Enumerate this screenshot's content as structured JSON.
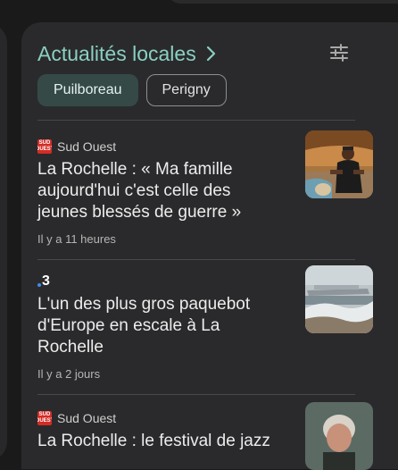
{
  "header": {
    "title": "Actualités locales"
  },
  "chips": [
    {
      "label": "Puilboreau",
      "selected": true
    },
    {
      "label": "Perigny",
      "selected": false
    }
  ],
  "articles": [
    {
      "source": "Sud Ouest",
      "source_logo": "SUD OUEST",
      "title": "La Rochelle : « Ma famille aujourd'hui c'est celle des jeunes blessés de guerre »",
      "time": "Il y a 11 heures",
      "thumbnail_icon": "man-on-stage-photo"
    },
    {
      "source": "3",
      "source_logo": "",
      "title": "L'un des plus gros paquebot d'Europe en escale à La Rochelle",
      "time": "Il y a 2 jours",
      "thumbnail_icon": "cruise-ship-photo"
    },
    {
      "source": "Sud Ouest",
      "source_logo": "SUD OUEST",
      "title": "La Rochelle : le festival de jazz",
      "thumbnail_icon": "jazz-musician-photo"
    }
  ],
  "colors": {
    "accent": "#8ad0c2",
    "chip_active_bg": "#354a47",
    "card_bg": "#2a2a2c",
    "source_logo_red": "#d32c26",
    "dot_blue": "#3d8cf0"
  }
}
